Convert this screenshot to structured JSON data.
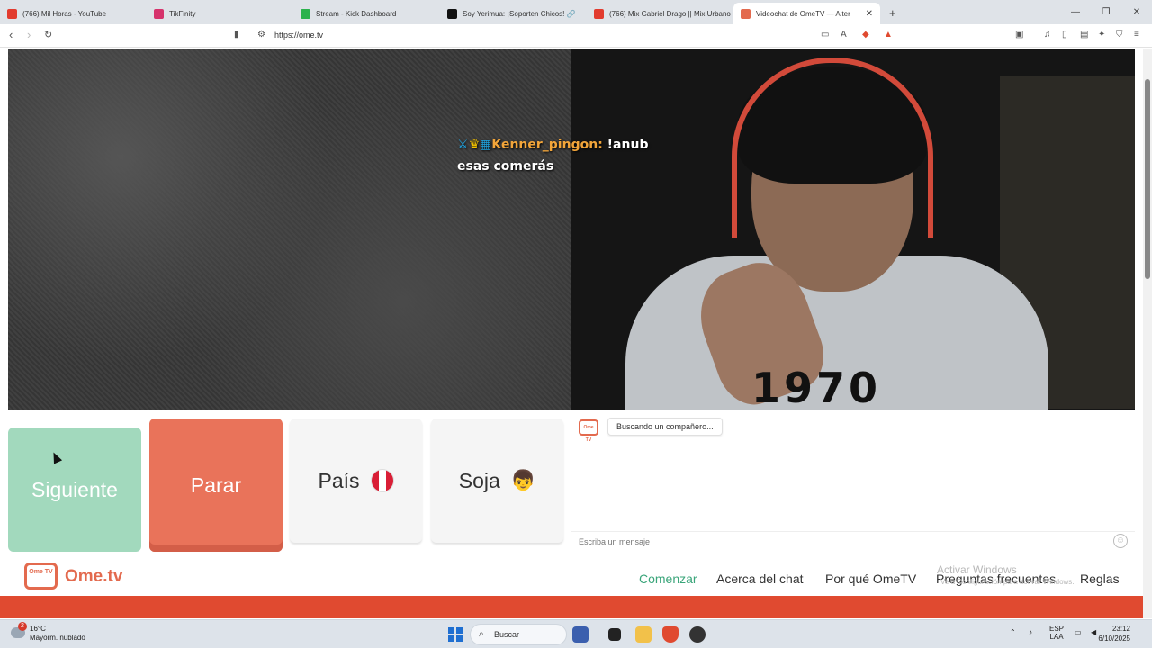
{
  "browser": {
    "tabs": [
      {
        "title": "(766) Mil Horas - YouTube",
        "color": "#e23b2e"
      },
      {
        "title": "TikFinity",
        "color": "#d6336c"
      },
      {
        "title": "Stream - Kick Dashboard",
        "color": "#2bb24c"
      },
      {
        "title": "Soy Yerimua: ¡Soporten Chicos! 🔗",
        "color": "#111111"
      },
      {
        "title": "(766) Mix Gabriel Drago || Mix Urbano",
        "color": "#e23b2e"
      },
      {
        "title": "Videochat de OmeTV — Alter",
        "color": "#e36a4e",
        "active": true
      }
    ],
    "new_tab": "+",
    "url": "https://ome.tv"
  },
  "overlay": {
    "username": "Kenner_pingon",
    "message": "!anub",
    "message2": "esas comerás"
  },
  "video": {
    "shirt_text": "1970"
  },
  "buttons": {
    "next": "Siguiente",
    "stop": "Parar",
    "country": "País",
    "gender": "Soja",
    "gender_emoji": "👦"
  },
  "chat": {
    "logo": "Ome TV",
    "status": "Buscando un compañero...",
    "placeholder": "Escriba un mensaje",
    "emoji_icon": "☺"
  },
  "site": {
    "logo_box": "Ome TV",
    "logo_text": "Ome.tv",
    "nav": [
      "Comenzar",
      "Acerca del chat",
      "Por qué OmeTV",
      "Preguntas frecuentes",
      "Reglas"
    ],
    "watermark_title": "Activar Windows",
    "watermark_sub": "Ve a Configuración para activar Windows."
  },
  "taskbar": {
    "notification_count": "2",
    "temperature": "16°C",
    "weather": "Mayorm. nublado",
    "search": "Buscar",
    "language": "ESP",
    "region": "LAA",
    "time": "23:12",
    "date": "6/10/2025"
  }
}
